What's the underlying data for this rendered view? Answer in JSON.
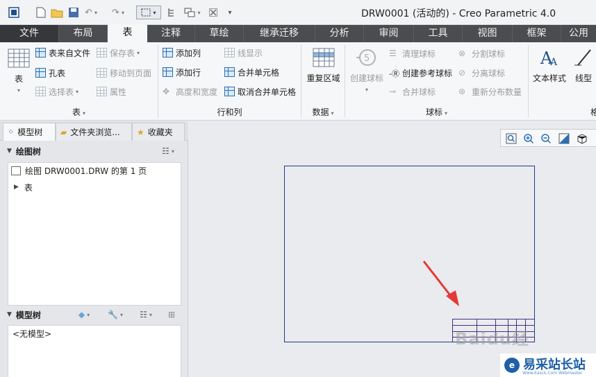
{
  "window": {
    "title": "DRW0001 (活动的) - Creo Parametric 4.0"
  },
  "quick_access": {
    "items": [
      "window-icon",
      "new-icon",
      "open-icon",
      "save-icon",
      "undo-icon",
      "redo-icon",
      "select-box-icon",
      "regenerate-icon",
      "windows-icon",
      "close-icon",
      "customize-icon"
    ]
  },
  "tabs": [
    {
      "label": "文件"
    },
    {
      "label": "布局"
    },
    {
      "label": "表"
    },
    {
      "label": "注释"
    },
    {
      "label": "草绘"
    },
    {
      "label": "继承迁移"
    },
    {
      "label": "分析"
    },
    {
      "label": "审阅"
    },
    {
      "label": "工具"
    },
    {
      "label": "视图"
    },
    {
      "label": "框架"
    },
    {
      "label": "公用"
    }
  ],
  "ribbon": {
    "table_group": {
      "table_button": "表",
      "table_from_file": "表来自文件",
      "save_table": "保存表",
      "hole_table": "孔表",
      "move_to_page": "移动到页面",
      "select_table": "选择表",
      "properties": "属性",
      "label": "表"
    },
    "rows_cols_group": {
      "add_column": "添加列",
      "line_display": "线显示",
      "add_row": "添加行",
      "merge_cells": "合并单元格",
      "height_width": "高度和宽度",
      "unmerge_cells": "取消合并单元格",
      "label": "行和列"
    },
    "data_group": {
      "repeat_region": "重复区域",
      "label": "数据"
    },
    "balloon_group": {
      "create_balloon": "创建球标",
      "clean_balloon": "清理球标",
      "create_ref_balloon": "创建参考球标",
      "merge_balloon": "合并球标",
      "split_balloon": "分割球标",
      "separate_balloon": "分离球标",
      "redistribute_qty": "重新分布数量",
      "label": "球标"
    },
    "format_group": {
      "text_style": "文本样式",
      "line_style": "线型",
      "label": "格"
    }
  },
  "side_panel": {
    "tabs": [
      {
        "label": "模型树"
      },
      {
        "label": "文件夹浏览..."
      },
      {
        "label": "收藏夹"
      }
    ],
    "drawing_tree": {
      "title": "绘图树",
      "rows": [
        "绘图 DRW0001.DRW 的第 1 页",
        "表"
      ]
    },
    "model_tree": {
      "title": "模型树",
      "empty_text": "<无模型>"
    }
  },
  "watermarks": {
    "baidu": "Baidu经",
    "site_name": "易采站长站",
    "site_sub": "Www.Easck.Com Webmaster",
    "logo_letter": "e"
  }
}
